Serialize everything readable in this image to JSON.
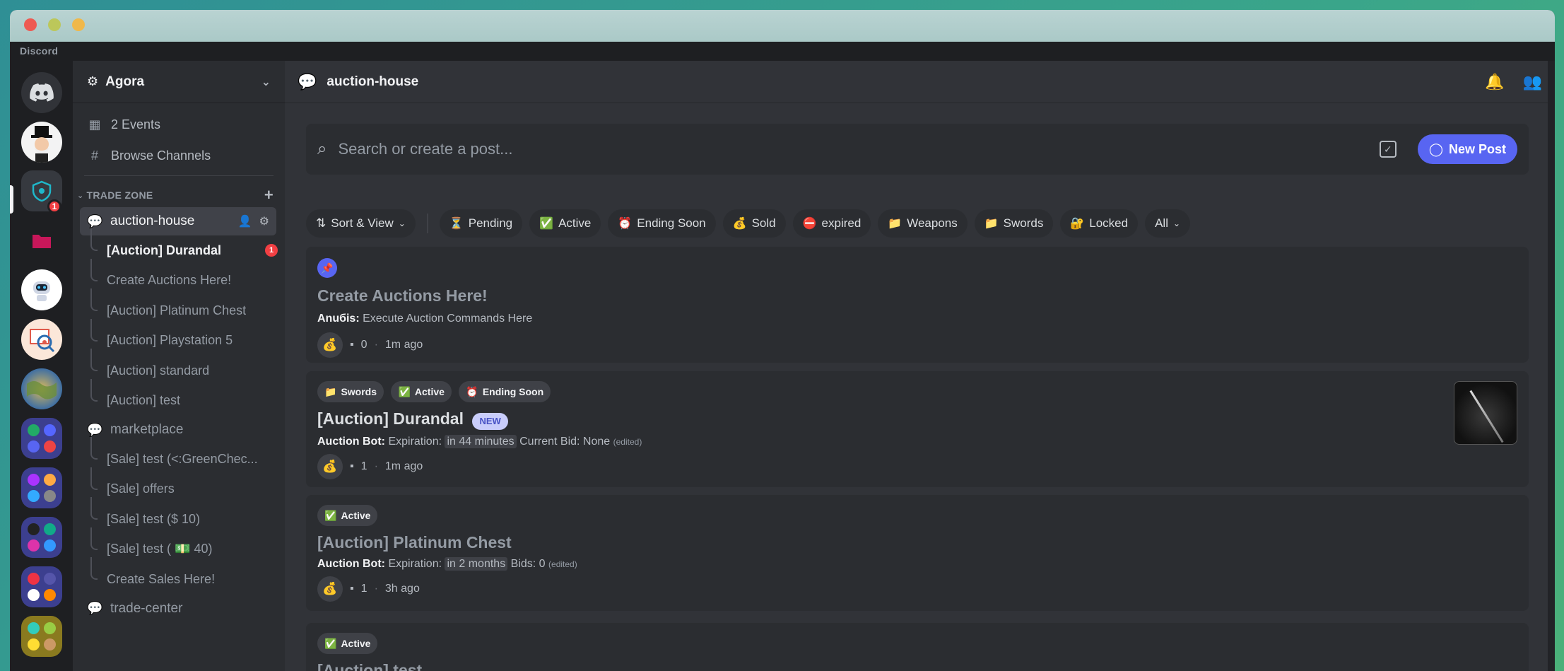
{
  "app_name": "Discord",
  "server": {
    "name": "Agora",
    "rail_badge": "1"
  },
  "sidebar": {
    "events": "2 Events",
    "browse": "Browse Channels",
    "category": "TRADE ZONE",
    "channels": [
      {
        "name": "auction-house",
        "threads": [
          {
            "label": "[Auction] Durandal",
            "badge": "1"
          },
          {
            "label": "Create Auctions Here!"
          },
          {
            "label": "[Auction] Platinum Chest"
          },
          {
            "label": "[Auction] Playstation 5"
          },
          {
            "label": "[Auction] standard"
          },
          {
            "label": "[Auction] test"
          }
        ]
      },
      {
        "name": "marketplace",
        "threads": [
          {
            "label": "[Sale] test (<:GreenChec..."
          },
          {
            "label": "[Sale] offers"
          },
          {
            "label": "[Sale] test ($ 10)"
          },
          {
            "label": "[Sale] test ( 💵 40)"
          },
          {
            "label": "Create Sales Here!"
          }
        ]
      },
      {
        "name": "trade-center"
      }
    ]
  },
  "header": {
    "channel": "auction-house"
  },
  "search": {
    "placeholder": "Search or create a post...",
    "new_post": "New Post"
  },
  "filters": [
    {
      "label": "Sort & View",
      "icon": "sort-icon"
    },
    {
      "label": "Pending",
      "emoji": "⏳"
    },
    {
      "label": "Active",
      "emoji": "✅"
    },
    {
      "label": "Ending Soon",
      "emoji": "⏰"
    },
    {
      "label": "Sold",
      "emoji": "💰"
    },
    {
      "label": "expired",
      "emoji": "⛔"
    },
    {
      "label": "Weapons",
      "emoji": "📁"
    },
    {
      "label": "Swords",
      "emoji": "📁"
    },
    {
      "label": "Locked",
      "emoji": "🔐"
    },
    {
      "label": "All"
    }
  ],
  "posts": [
    {
      "title": "Create Auctions Here!",
      "author": "Anuбis:",
      "text": "Execute Auction Commands Here",
      "comments": "0",
      "time": "1m ago"
    },
    {
      "tags": [
        "Swords",
        "Active",
        "Ending Soon"
      ],
      "title": "[Auction] Durandal",
      "new_label": "NEW",
      "author": "Auction Bot:",
      "text_a": "Expiration:",
      "highlight": "in 44 minutes",
      "text_b": "Current Bid: None",
      "edited": "(edited)",
      "comments": "1",
      "time": "1m ago"
    },
    {
      "tags": [
        "Active"
      ],
      "title": "[Auction] Platinum Chest",
      "author": "Auction Bot:",
      "text_a": "Expiration:",
      "highlight": "in 2 months",
      "text_b": "Bids: 0",
      "edited": "(edited)",
      "comments": "1",
      "time": "3h ago"
    },
    {
      "tags": [
        "Active"
      ],
      "title": "[Auction] test"
    }
  ]
}
